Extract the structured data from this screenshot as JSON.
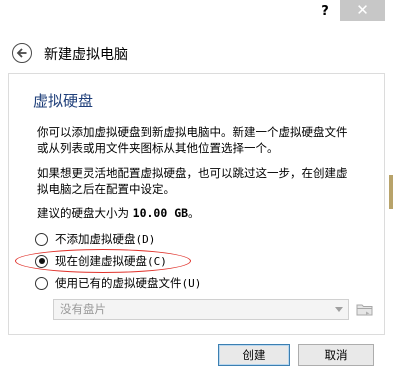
{
  "titlebar": {
    "help_label": "?",
    "close_label": "✕"
  },
  "header": {
    "title": "新建虚拟电脑"
  },
  "section": {
    "title": "虚拟硬盘"
  },
  "paragraphs": {
    "p1_line1": "你可以添加虚拟硬盘到新虚拟电脑中。新建一个虚拟硬盘文件",
    "p1_line2": "或从列表或用文件夹图标从其他位置选择一个。",
    "p2_line1": "如果想更灵活地配置虚拟硬盘，也可以跳过这一步，在创建虚",
    "p2_line2": "拟电脑之后在配置中设定。",
    "recommended_prefix": "建议的硬盘大小为 ",
    "recommended_size": "10.00 GB",
    "recommended_suffix": "。"
  },
  "options": [
    {
      "label": "不添加虚拟硬盘",
      "shortcut": "(D)",
      "checked": false
    },
    {
      "label": "现在创建虚拟硬盘",
      "shortcut": "(C)",
      "checked": true
    },
    {
      "label": "使用已有的虚拟硬盘文件",
      "shortcut": "(U)",
      "checked": false
    }
  ],
  "file_select": {
    "value": "没有盘片"
  },
  "buttons": {
    "create": "创建",
    "cancel": "取消"
  },
  "colors": {
    "section_title": "#1f3f7a",
    "highlight": "#e0322b",
    "close_bg": "#c7c7c7"
  }
}
